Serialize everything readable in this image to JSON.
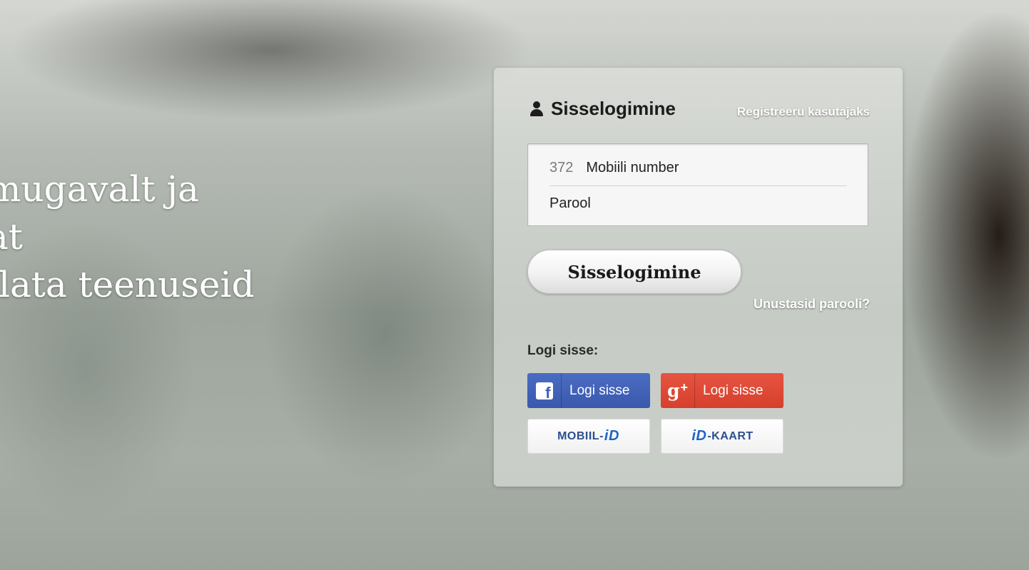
{
  "hero": {
    "line1": " mugavalt ja",
    "line2": "at",
    "line3": "llata teenuseid"
  },
  "login": {
    "title": "Sisselogimine",
    "title_icon": "user-icon",
    "register_link": "Registreeru kasutajaks",
    "phone_prefix": "372",
    "phone_placeholder": "Mobiili number",
    "password_placeholder": "Parool",
    "submit_label": "Sisselogimine",
    "forgot_link": "Unustasid parooli?"
  },
  "social": {
    "label": "Logi sisse:",
    "facebook": {
      "label": "Logi sisse",
      "icon": "facebook-icon",
      "color": "#3f61b6"
    },
    "google": {
      "label": "Logi sisse",
      "icon": "google-plus-icon",
      "color": "#dd4b39"
    },
    "mobiil_id": {
      "prefix": "MOBIIL-",
      "id": "iD",
      "suffix": ""
    },
    "id_kaart": {
      "prefix": "",
      "id": "iD",
      "suffix": "-KAART"
    }
  }
}
